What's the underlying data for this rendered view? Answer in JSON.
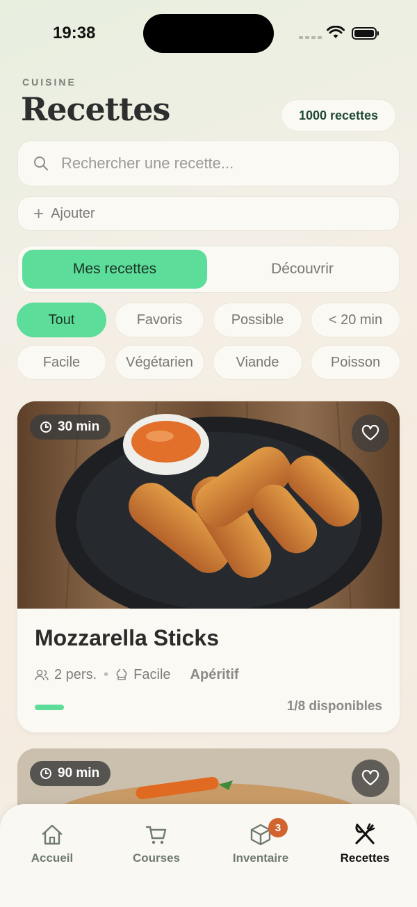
{
  "status_bar": {
    "time": "19:38"
  },
  "header": {
    "eyebrow": "CUISINE",
    "title": "Recettes",
    "count_badge": "1000 recettes"
  },
  "search": {
    "placeholder": "Rechercher une recette..."
  },
  "add": {
    "label": "Ajouter"
  },
  "segments": {
    "mine": "Mes recettes",
    "discover": "Découvrir"
  },
  "filters": [
    "Tout",
    "Favoris",
    "Possible",
    "< 20 min",
    "Facile",
    "Végétarien",
    "Viande",
    "Poisson"
  ],
  "recipes": [
    {
      "time": "30 min",
      "title": "Mozzarella Sticks",
      "servings": "2 pers.",
      "difficulty": "Facile",
      "category": "Apéritif",
      "availability": "1/8 disponibles",
      "availability_fraction": 0.125
    },
    {
      "time": "90 min"
    }
  ],
  "tabbar": {
    "home": "Accueil",
    "courses": "Courses",
    "inventory": "Inventaire",
    "inventory_badge": "3",
    "recipes": "Recettes"
  },
  "colors": {
    "accent": "#5ddd9a",
    "badge": "#d2652f",
    "count_text": "#1e4a33"
  }
}
